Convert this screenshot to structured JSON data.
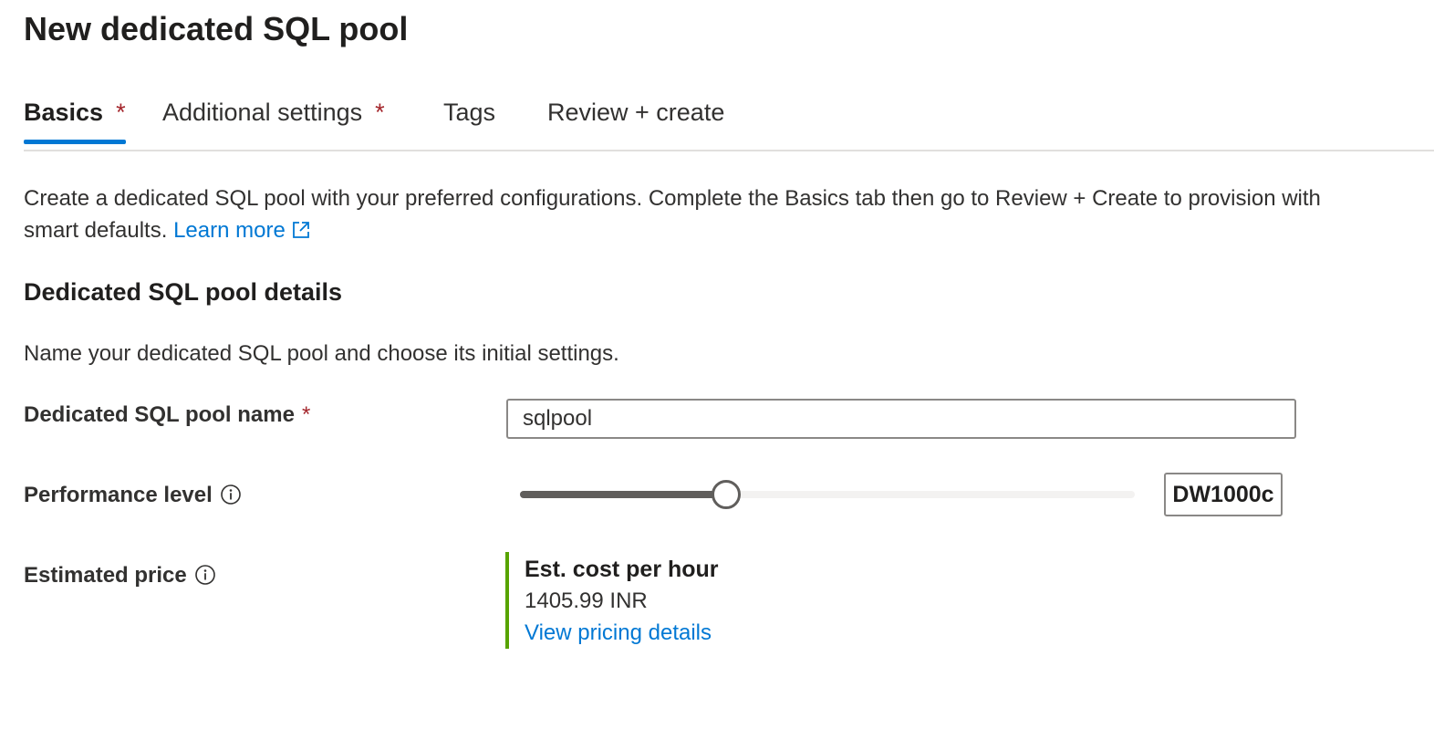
{
  "page": {
    "title": "New dedicated SQL pool"
  },
  "tabs": [
    {
      "label": "Basics",
      "required": "*",
      "active": true
    },
    {
      "label": "Additional settings",
      "required": "*",
      "active": false
    },
    {
      "label": "Tags",
      "required": "",
      "active": false
    },
    {
      "label": "Review + create",
      "required": "",
      "active": false
    }
  ],
  "intro": {
    "text": "Create a dedicated SQL pool with your preferred configurations. Complete the Basics tab then go to Review + Create to provision with smart defaults.",
    "learn_more": "Learn more"
  },
  "section": {
    "title": "Dedicated SQL pool details",
    "description": "Name your dedicated SQL pool and choose its initial settings."
  },
  "fields": {
    "pool_name": {
      "label": "Dedicated SQL pool name",
      "required": "*",
      "value": "sqlpool"
    },
    "performance": {
      "label": "Performance level",
      "value": "DW1000c",
      "slider_fraction": 0.335
    },
    "price": {
      "label": "Estimated price",
      "title": "Est. cost per hour",
      "value": "1405.99 INR",
      "link": "View pricing details"
    }
  },
  "colors": {
    "accent": "#0078d4",
    "required": "#a4262c",
    "price_bar": "#57a300"
  },
  "icons": {
    "external_link": "external-link-icon",
    "info": "info-icon"
  }
}
